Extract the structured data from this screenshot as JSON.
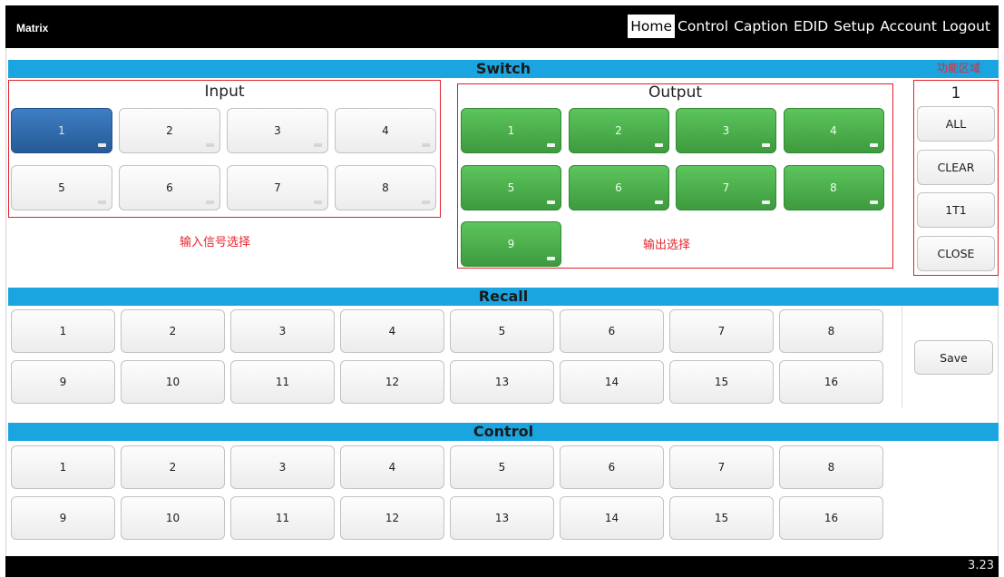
{
  "app": {
    "brand": "Matrix",
    "version": "3.23"
  },
  "nav": [
    "Home",
    "Control",
    "Caption",
    "EDID",
    "Setup",
    "Account",
    "Logout"
  ],
  "nav_active": "Home",
  "colors": {
    "accent": "#1aa5e0",
    "input_selected": "#336fb0",
    "output_active": "#4caf50",
    "annotation": "#e0202a"
  },
  "switch": {
    "header": "Switch",
    "input": {
      "title": "Input",
      "buttons": [
        "1",
        "2",
        "3",
        "4",
        "5",
        "6",
        "7",
        "8"
      ],
      "selected": "1",
      "annotation": "输入信号选择"
    },
    "output": {
      "title": "Output",
      "buttons": [
        "1",
        "2",
        "3",
        "4",
        "5",
        "6",
        "7",
        "8",
        "9"
      ],
      "annotation": "输出选择"
    },
    "function": {
      "annotation": "功能区域",
      "current": "1",
      "buttons": [
        "ALL",
        "CLEAR",
        "1T1",
        "CLOSE"
      ]
    }
  },
  "recall": {
    "header": "Recall",
    "buttons": [
      "1",
      "2",
      "3",
      "4",
      "5",
      "6",
      "7",
      "8",
      "9",
      "10",
      "11",
      "12",
      "13",
      "14",
      "15",
      "16"
    ],
    "save_label": "Save"
  },
  "control": {
    "header": "Control",
    "buttons": [
      "1",
      "2",
      "3",
      "4",
      "5",
      "6",
      "7",
      "8",
      "9",
      "10",
      "11",
      "12",
      "13",
      "14",
      "15",
      "16"
    ]
  }
}
